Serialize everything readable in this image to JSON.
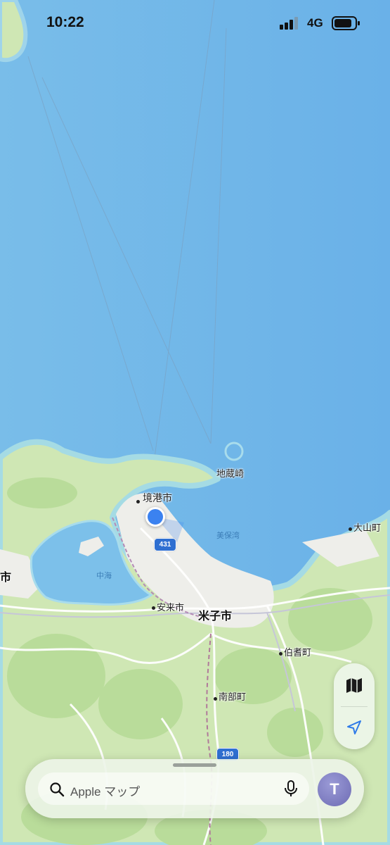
{
  "status_bar": {
    "time": "10:22",
    "network": "4G",
    "signal_bars_filled": 3,
    "signal_bars_total": 4
  },
  "map": {
    "labels": {
      "jizo_zaki": "地蔵崎",
      "sakaiminato": "境港市",
      "mihonoseki_bay": "美保湾",
      "daisen": "大山町",
      "city_left_edge": "市",
      "nakaumi": "中海",
      "yasugi": "安来市",
      "yonago": "米子市",
      "hoki": "伯耆町",
      "nanbu": "南部町"
    },
    "route_shields": {
      "r431": "431",
      "r180": "180"
    },
    "colors": {
      "sea": "#6fb6e9",
      "land": "#cfe7b4",
      "user_location": "#3b82f0",
      "route_shield": "#2f6fd1"
    }
  },
  "controls": {
    "map_mode_icon": "map-icon",
    "locate_icon": "location-arrow-icon"
  },
  "search": {
    "placeholder": "Apple マップ",
    "avatar_initial": "T"
  }
}
